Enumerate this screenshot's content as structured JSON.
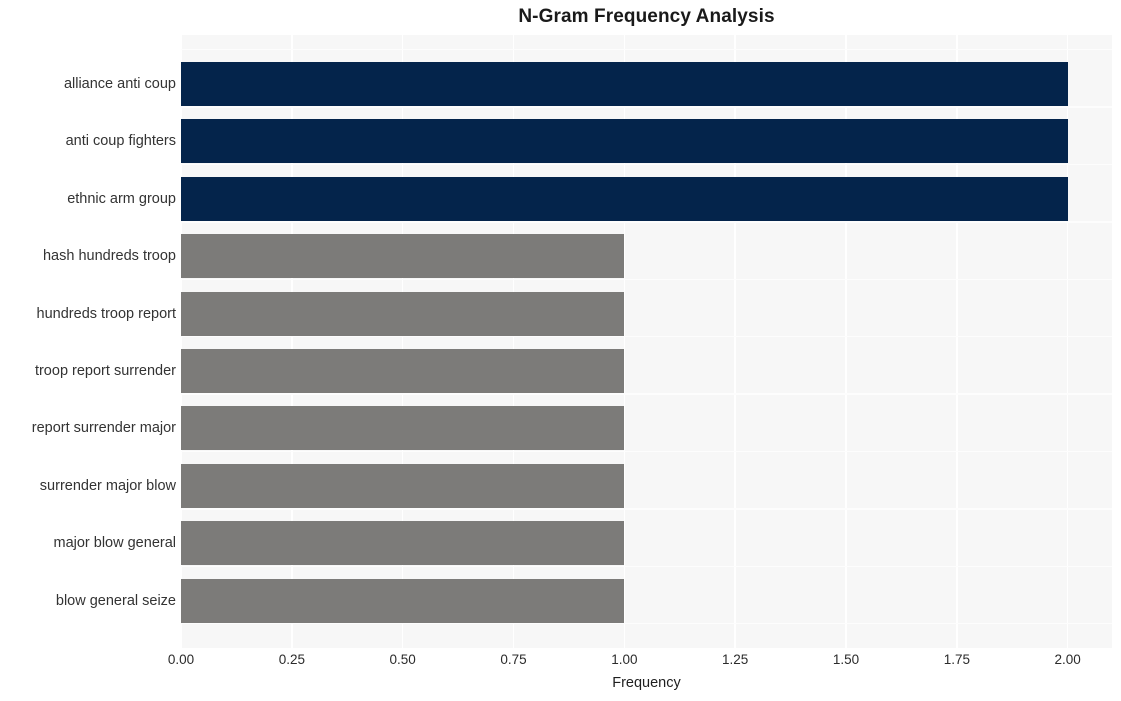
{
  "chart_data": {
    "type": "bar",
    "orientation": "horizontal",
    "title": "N-Gram Frequency Analysis",
    "xlabel": "Frequency",
    "ylabel": "",
    "xlim": [
      0.0,
      2.1
    ],
    "xticks": [
      "0.00",
      "0.25",
      "0.50",
      "0.75",
      "1.00",
      "1.25",
      "1.50",
      "1.75",
      "2.00"
    ],
    "xtick_values": [
      0.0,
      0.25,
      0.5,
      0.75,
      1.0,
      1.25,
      1.5,
      1.75,
      2.0
    ],
    "grid": true,
    "legend": "none",
    "categories": [
      "alliance anti coup",
      "anti coup fighters",
      "ethnic arm group",
      "hash hundreds troop",
      "hundreds troop report",
      "troop report surrender",
      "report surrender major",
      "surrender major blow",
      "major blow general",
      "blow general seize"
    ],
    "values": [
      2,
      2,
      2,
      1,
      1,
      1,
      1,
      1,
      1,
      1
    ],
    "bars": [
      {
        "label": "alliance anti coup",
        "value": 2,
        "color": "#04244b"
      },
      {
        "label": "anti coup fighters",
        "value": 2,
        "color": "#04244b"
      },
      {
        "label": "ethnic arm group",
        "value": 2,
        "color": "#04244b"
      },
      {
        "label": "hash hundreds troop",
        "value": 1,
        "color": "#7c7b79"
      },
      {
        "label": "hundreds troop report",
        "value": 1,
        "color": "#7c7b79"
      },
      {
        "label": "troop report surrender",
        "value": 1,
        "color": "#7c7b79"
      },
      {
        "label": "report surrender major",
        "value": 1,
        "color": "#7c7b79"
      },
      {
        "label": "surrender major blow",
        "value": 1,
        "color": "#7c7b79"
      },
      {
        "label": "major blow general",
        "value": 1,
        "color": "#7c7b79"
      },
      {
        "label": "blow general seize",
        "value": 1,
        "color": "#7c7b79"
      }
    ],
    "colors": {
      "high_frequency_bar": "#04244b",
      "low_frequency_bar": "#7c7b79",
      "plot_background": "#f7f7f7",
      "gridline": "#ffffff",
      "figure_background": "#ffffff",
      "text": "#333333"
    }
  }
}
